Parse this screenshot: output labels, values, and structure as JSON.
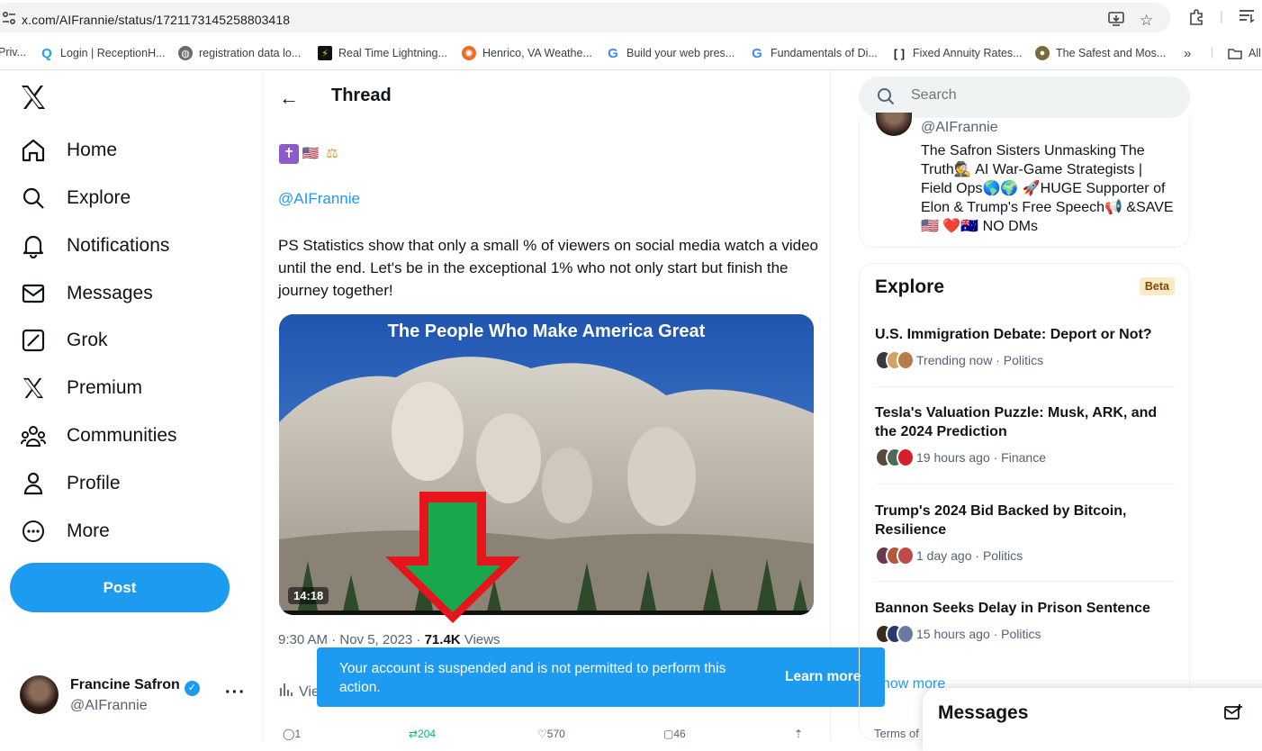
{
  "browser": {
    "url": "x.com/AIFrannie/status/1721173145258803418",
    "bookmarks": [
      {
        "label": "Priv...",
        "icon": "doc-icon"
      },
      {
        "label": "Login | ReceptionH...",
        "icon": "q-icon"
      },
      {
        "label": "registration data lo...",
        "icon": "globe-icon"
      },
      {
        "label": "Real Time Lightning...",
        "icon": "bolt-icon"
      },
      {
        "label": "Henrico, VA Weathe...",
        "icon": "sun-icon"
      },
      {
        "label": "Build your web pres...",
        "icon": "google-icon"
      },
      {
        "label": "Fundamentals of Di...",
        "icon": "google-icon"
      },
      {
        "label": "Fixed Annuity Rates...",
        "icon": "bracket-icon"
      },
      {
        "label": "The Safest and Mos...",
        "icon": "seal-icon"
      },
      {
        "label": "All",
        "icon": "folder-icon"
      }
    ],
    "more_bookmarks": "»"
  },
  "nav": {
    "logo": "𝕏",
    "items": [
      {
        "label": "Home",
        "icon": "home-icon"
      },
      {
        "label": "Explore",
        "icon": "search-icon"
      },
      {
        "label": "Notifications",
        "icon": "bell-icon"
      },
      {
        "label": "Messages",
        "icon": "mail-icon"
      },
      {
        "label": "Grok",
        "icon": "grok-icon"
      },
      {
        "label": "Premium",
        "icon": "x-logo-icon"
      },
      {
        "label": "Communities",
        "icon": "people-icon"
      },
      {
        "label": "Profile",
        "icon": "person-icon"
      },
      {
        "label": "More",
        "icon": "more-circle-icon"
      }
    ],
    "post_label": "Post"
  },
  "account": {
    "name": "Francine Safron",
    "handle": "@AIFrannie",
    "more": "···"
  },
  "thread": {
    "back": "←",
    "title": "Thread",
    "emojis": [
      "✝",
      "🇺🇸",
      "⚖"
    ],
    "mention": "@AIFrannie",
    "text": "PS Statistics show that only a small % of viewers on social media watch a video until the end. Let's be in the exceptional 1% who not only start but finish the journey together!",
    "media_caption": "The People Who Make America Great",
    "duration": "14:18",
    "time": "9:30 AM · Nov 5, 2023 · ",
    "views_count": "71.4K",
    "views_label": " Views",
    "view_link": "Vie",
    "actions": {
      "replies": "1",
      "reposts": "204",
      "likes": "570",
      "bookmarks": "46"
    }
  },
  "toast": {
    "text": "Your account is suspended and is not permitted to perform this action.",
    "link": "Learn more"
  },
  "sidebar": {
    "search_placeholder": "Search",
    "profile_card": {
      "handle": "@AIFrannie",
      "bio": "The Safron Sisters Unmasking The Truth🕵 AI War-Game Strategists | Field Ops🌎🌍 🚀HUGE Supporter of Elon & Trump's Free Speech📢 &SAVE 🇺🇸 ❤️🇦🇺 NO DMs"
    },
    "explore": {
      "title": "Explore",
      "badge": "Beta",
      "trends": [
        {
          "title": "U.S. Immigration Debate: Deport or Not?",
          "meta": "Trending now · Politics"
        },
        {
          "title": "Tesla's Valuation Puzzle: Musk, ARK, and the 2024 Prediction",
          "meta": "19 hours ago · Finance"
        },
        {
          "title": "Trump's 2024 Bid Backed by Bitcoin, Resilience",
          "meta": "1 day ago · Politics"
        },
        {
          "title": "Bannon Seeks Delay in Prison Sentence",
          "meta": "15 hours ago · Politics"
        }
      ],
      "show_more": "how more"
    },
    "terms": "Terms of"
  },
  "messages_dock": {
    "title": "Messages"
  }
}
